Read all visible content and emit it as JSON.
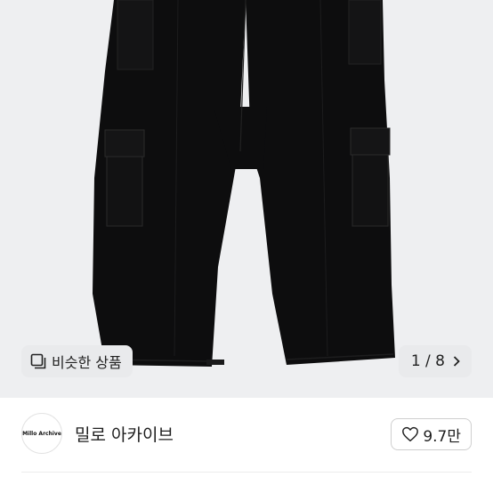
{
  "product_image": {
    "similar_label": "비슷한 상품",
    "similar_icon": "similar-items-icon",
    "page_indicator": "1 / 8",
    "next_icon": "chevron-right-icon"
  },
  "seller": {
    "avatar_text": "Millo Archive",
    "name": "밀로 아카이브",
    "likes": "9.7만",
    "like_icon": "heart-icon"
  },
  "colors": {
    "image_bg": "#eeeff1",
    "pants": "#0d0d0e",
    "chip_bg": "#e9eaec"
  }
}
